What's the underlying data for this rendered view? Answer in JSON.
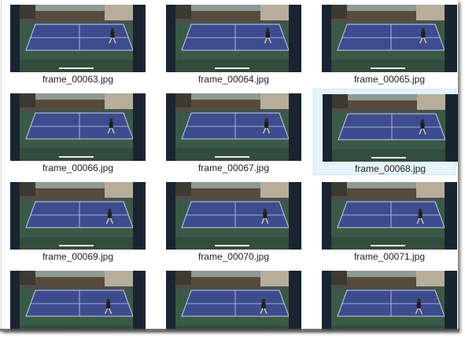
{
  "files": [
    {
      "name": "frame_00063.jpg",
      "selected": false
    },
    {
      "name": "frame_00064.jpg",
      "selected": false
    },
    {
      "name": "frame_00065.jpg",
      "selected": false
    },
    {
      "name": "frame_00066.jpg",
      "selected": false
    },
    {
      "name": "frame_00067.jpg",
      "selected": false
    },
    {
      "name": "frame_00068.jpg",
      "selected": true
    },
    {
      "name": "frame_00069.jpg",
      "selected": false
    },
    {
      "name": "frame_00070.jpg",
      "selected": false
    },
    {
      "name": "frame_00071.jpg",
      "selected": false
    },
    {
      "name": "",
      "selected": false
    },
    {
      "name": "",
      "selected": false
    },
    {
      "name": "",
      "selected": false
    }
  ],
  "colors": {
    "selection_bg": "#e5f3fb",
    "selection_border": "#cde8f7",
    "court_blue": "#3d4c8e",
    "court_green": "#3a5a48",
    "frame_dark": "#1a2431"
  }
}
